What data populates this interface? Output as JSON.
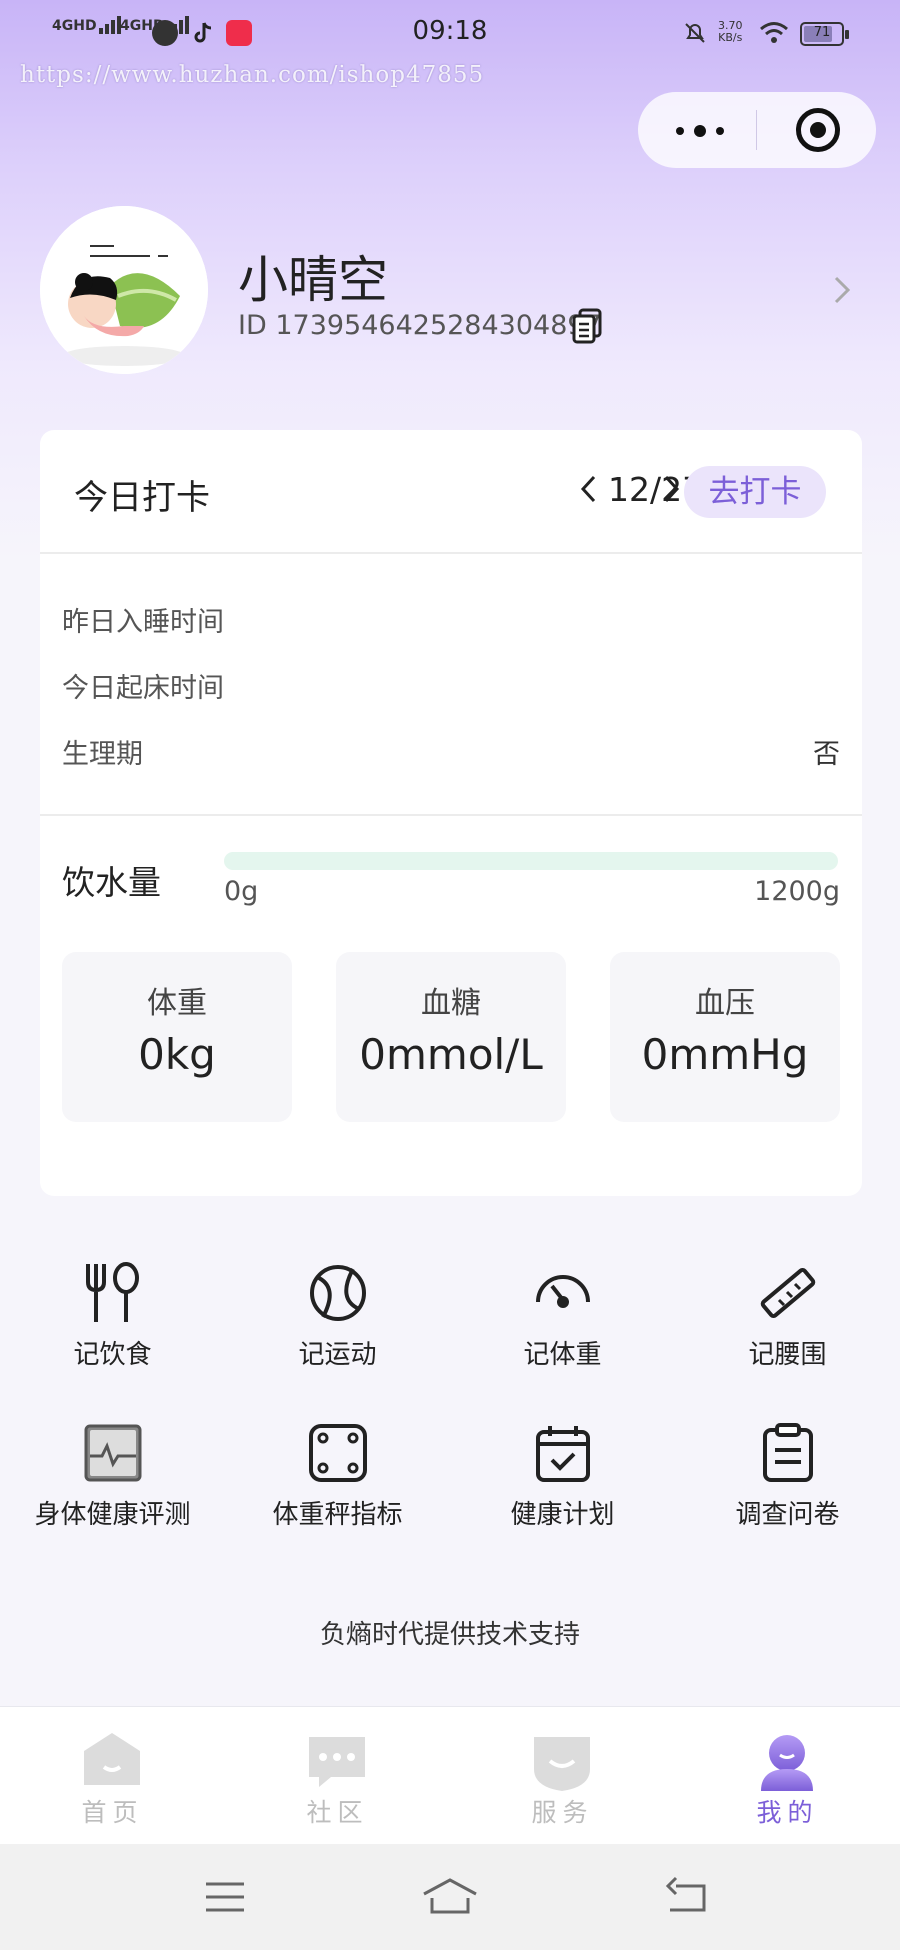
{
  "status_bar": {
    "time": "09:18",
    "signal1": "4GHD",
    "signal2": "4GHD",
    "speed_value": "3.70",
    "speed_unit": "KB/s",
    "battery": "71"
  },
  "watermark": "https://www.huzhan.com/ishop47855",
  "profile": {
    "name": "小晴空",
    "id_text": "ID 1739546425284304897"
  },
  "checkin": {
    "title": "今日打卡",
    "date": "12/27",
    "button": "去打卡",
    "rows": [
      {
        "label": "昨日入睡时间",
        "value": ""
      },
      {
        "label": "今日起床时间",
        "value": ""
      },
      {
        "label": "生理期",
        "value": "否"
      }
    ],
    "water": {
      "label": "饮水量",
      "min": "0g",
      "max": "1200g",
      "fraction": 0
    },
    "metrics": [
      {
        "label": "体重",
        "value": "0kg"
      },
      {
        "label": "血糖",
        "value": "0mmol/L"
      },
      {
        "label": "血压",
        "value": "0mmHg"
      }
    ]
  },
  "quick_actions": [
    {
      "label": "记饮食",
      "icon": "fork-spoon-icon"
    },
    {
      "label": "记运动",
      "icon": "ball-icon"
    },
    {
      "label": "记体重",
      "icon": "gauge-icon"
    },
    {
      "label": "记腰围",
      "icon": "ruler-icon"
    },
    {
      "label": "身体健康评测",
      "icon": "health-chart-icon"
    },
    {
      "label": "体重秤指标",
      "icon": "scale-icon"
    },
    {
      "label": "健康计划",
      "icon": "calendar-check-icon"
    },
    {
      "label": "调查问卷",
      "icon": "clipboard-icon"
    }
  ],
  "footer": "负熵时代提供技术支持",
  "tabbar": [
    {
      "label": "首页",
      "icon": "home-icon",
      "active": false
    },
    {
      "label": "社区",
      "icon": "chat-icon",
      "active": false
    },
    {
      "label": "服务",
      "icon": "service-icon",
      "active": false
    },
    {
      "label": "我的",
      "icon": "profile-icon",
      "active": true
    }
  ],
  "colors": {
    "accent": "#7c5fd8",
    "accent_light": "#ebe4fb",
    "water_track": "#e4f6ee",
    "header_gradient_top": "#c8b4f7"
  }
}
